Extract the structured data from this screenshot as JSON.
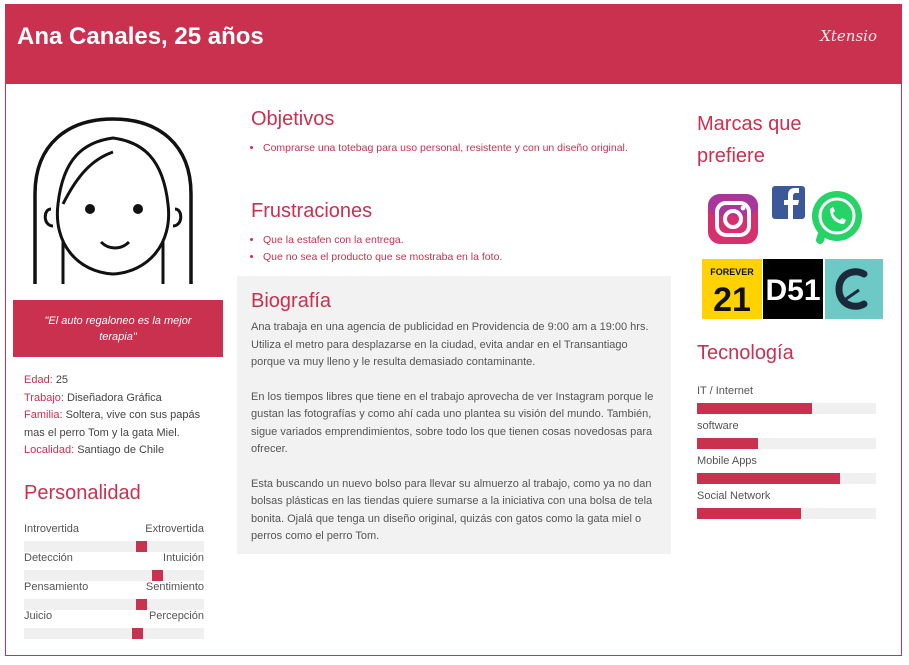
{
  "header": {
    "title": "Ana Canales, 25 años",
    "brand": "Xtensio"
  },
  "quote": "\"El auto regaloneo es la mejor terapia\"",
  "facts": [
    {
      "key": "Edad:",
      "value": "25"
    },
    {
      "key": "Trabajo:",
      "value": "Diseñadora Gráfica"
    },
    {
      "key": "Familia:",
      "value": "Soltera, vive con sus papás mas el perro Tom y la gata Miel."
    },
    {
      "key": "Localidad:",
      "value": "Santiago de Chile"
    }
  ],
  "personality": {
    "title": "Personalidad",
    "traits": [
      {
        "left": "Introvertida",
        "right": "Extrovertida",
        "level": 0.65
      },
      {
        "left": "Detección",
        "right": "Intuición",
        "level": 0.74
      },
      {
        "left": "Pensamiento",
        "right": "Sentimiento",
        "level": 0.65
      },
      {
        "left": "Juicio",
        "right": "Percepción",
        "level": 0.63
      }
    ]
  },
  "goals": {
    "title": "Objetivos",
    "items": [
      "Comprarse una totebag para uso personal, resistente y con un diseño original."
    ]
  },
  "frustrations": {
    "title": "Frustraciones",
    "items": [
      "Que la estafen con la entrega.",
      "Que no sea el producto que se mostraba en la foto."
    ]
  },
  "bio": {
    "title": "Biografía",
    "paragraphs": [
      "Ana trabaja en una agencia de publicidad en Providencia de 9:00 am a 19:00 hrs. Utiliza el metro para desplazarse en la ciudad, evita andar en el Transantiago porque va muy lleno y le resulta demasiado contaminante.",
      "En los tiempos libres que tiene en el trabajo aprovecha de ver Instagram porque le gustan las fotografías y como ahí cada uno plantea su visión del mundo. También, sigue variados emprendimientos, sobre todo los que tienen cosas novedosas para ofrecer.",
      "Esta buscando un nuevo bolso para llevar su almuerzo al trabajo, como ya no dan bolsas plásticas en las tiendas quiere sumarse a la iniciativa con una bolsa de tela bonita. Ojalá que tenga un diseño original, quizás con gatos como la gata miel o perros como el perro Tom."
    ]
  },
  "brands": {
    "title": "Marcas que prefiere",
    "logos": [
      {
        "icon": "instagram-icon",
        "color": "#d6306e"
      },
      {
        "icon": "facebook-icon",
        "color": "#3b5998"
      },
      {
        "icon": "whatsapp-icon",
        "color": "#25d366"
      },
      {
        "icon": "forever21-logo",
        "text": "FOREVER",
        "text2": "21",
        "color": "#ffd200"
      },
      {
        "icon": "d51-logo",
        "text": "D51",
        "color": "#000000"
      },
      {
        "icon": "c-brand-logo",
        "color": "#6cc9c6"
      }
    ]
  },
  "technology": {
    "title": "Tecnología",
    "items": [
      {
        "label": "IT / Internet",
        "level": 0.64
      },
      {
        "label": "software",
        "level": 0.34
      },
      {
        "label": "Mobile Apps",
        "level": 0.8
      },
      {
        "label": "Social Network",
        "level": 0.58
      }
    ]
  },
  "colors": {
    "accent": "#c9314f",
    "panel": "#f2f2f2",
    "track": "#f0f0f0"
  }
}
